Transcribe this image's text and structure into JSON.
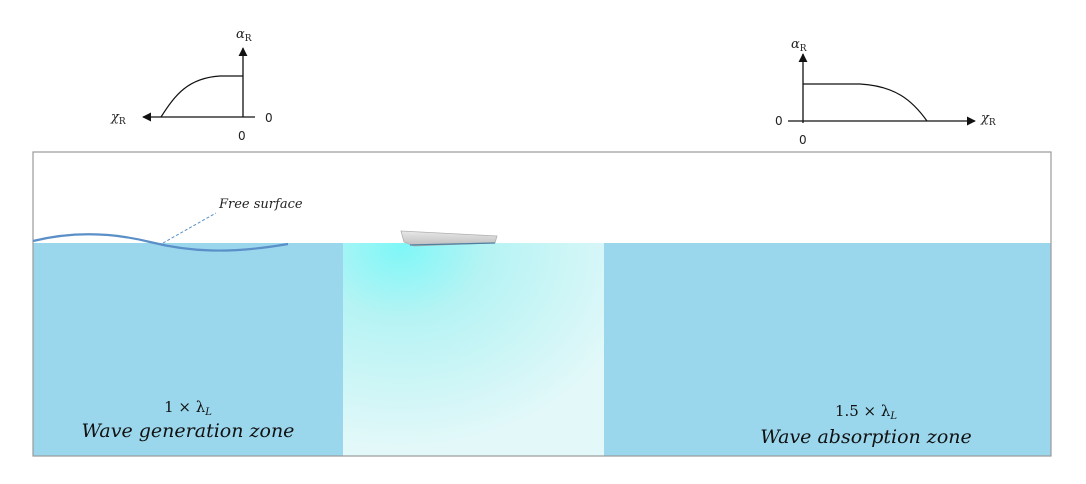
{
  "left_plot": {
    "y_label": "α",
    "y_label_sub": "R",
    "x_label": "χ",
    "x_label_sub": "R",
    "origin_x": "0",
    "origin_y": "0"
  },
  "right_plot": {
    "y_label": "α",
    "y_label_sub": "R",
    "x_label": "χ",
    "x_label_sub": "R",
    "origin_x": "0",
    "origin_y": "0"
  },
  "free_surface": {
    "label": "Free surface"
  },
  "zones": {
    "generation": {
      "factor_prefix": "1 × λ",
      "factor_sub": "L",
      "title": "Wave generation zone"
    },
    "absorption": {
      "factor_prefix": "1.5 × λ",
      "factor_sub": "L",
      "title": "Wave absorption zone"
    }
  },
  "colors": {
    "water": "#9ad7ed",
    "border": "#9a9a9a",
    "surface_line": "#5a8fc8",
    "glow_center": "#7ff7f7",
    "glow_edge": "#e3f8f9"
  }
}
